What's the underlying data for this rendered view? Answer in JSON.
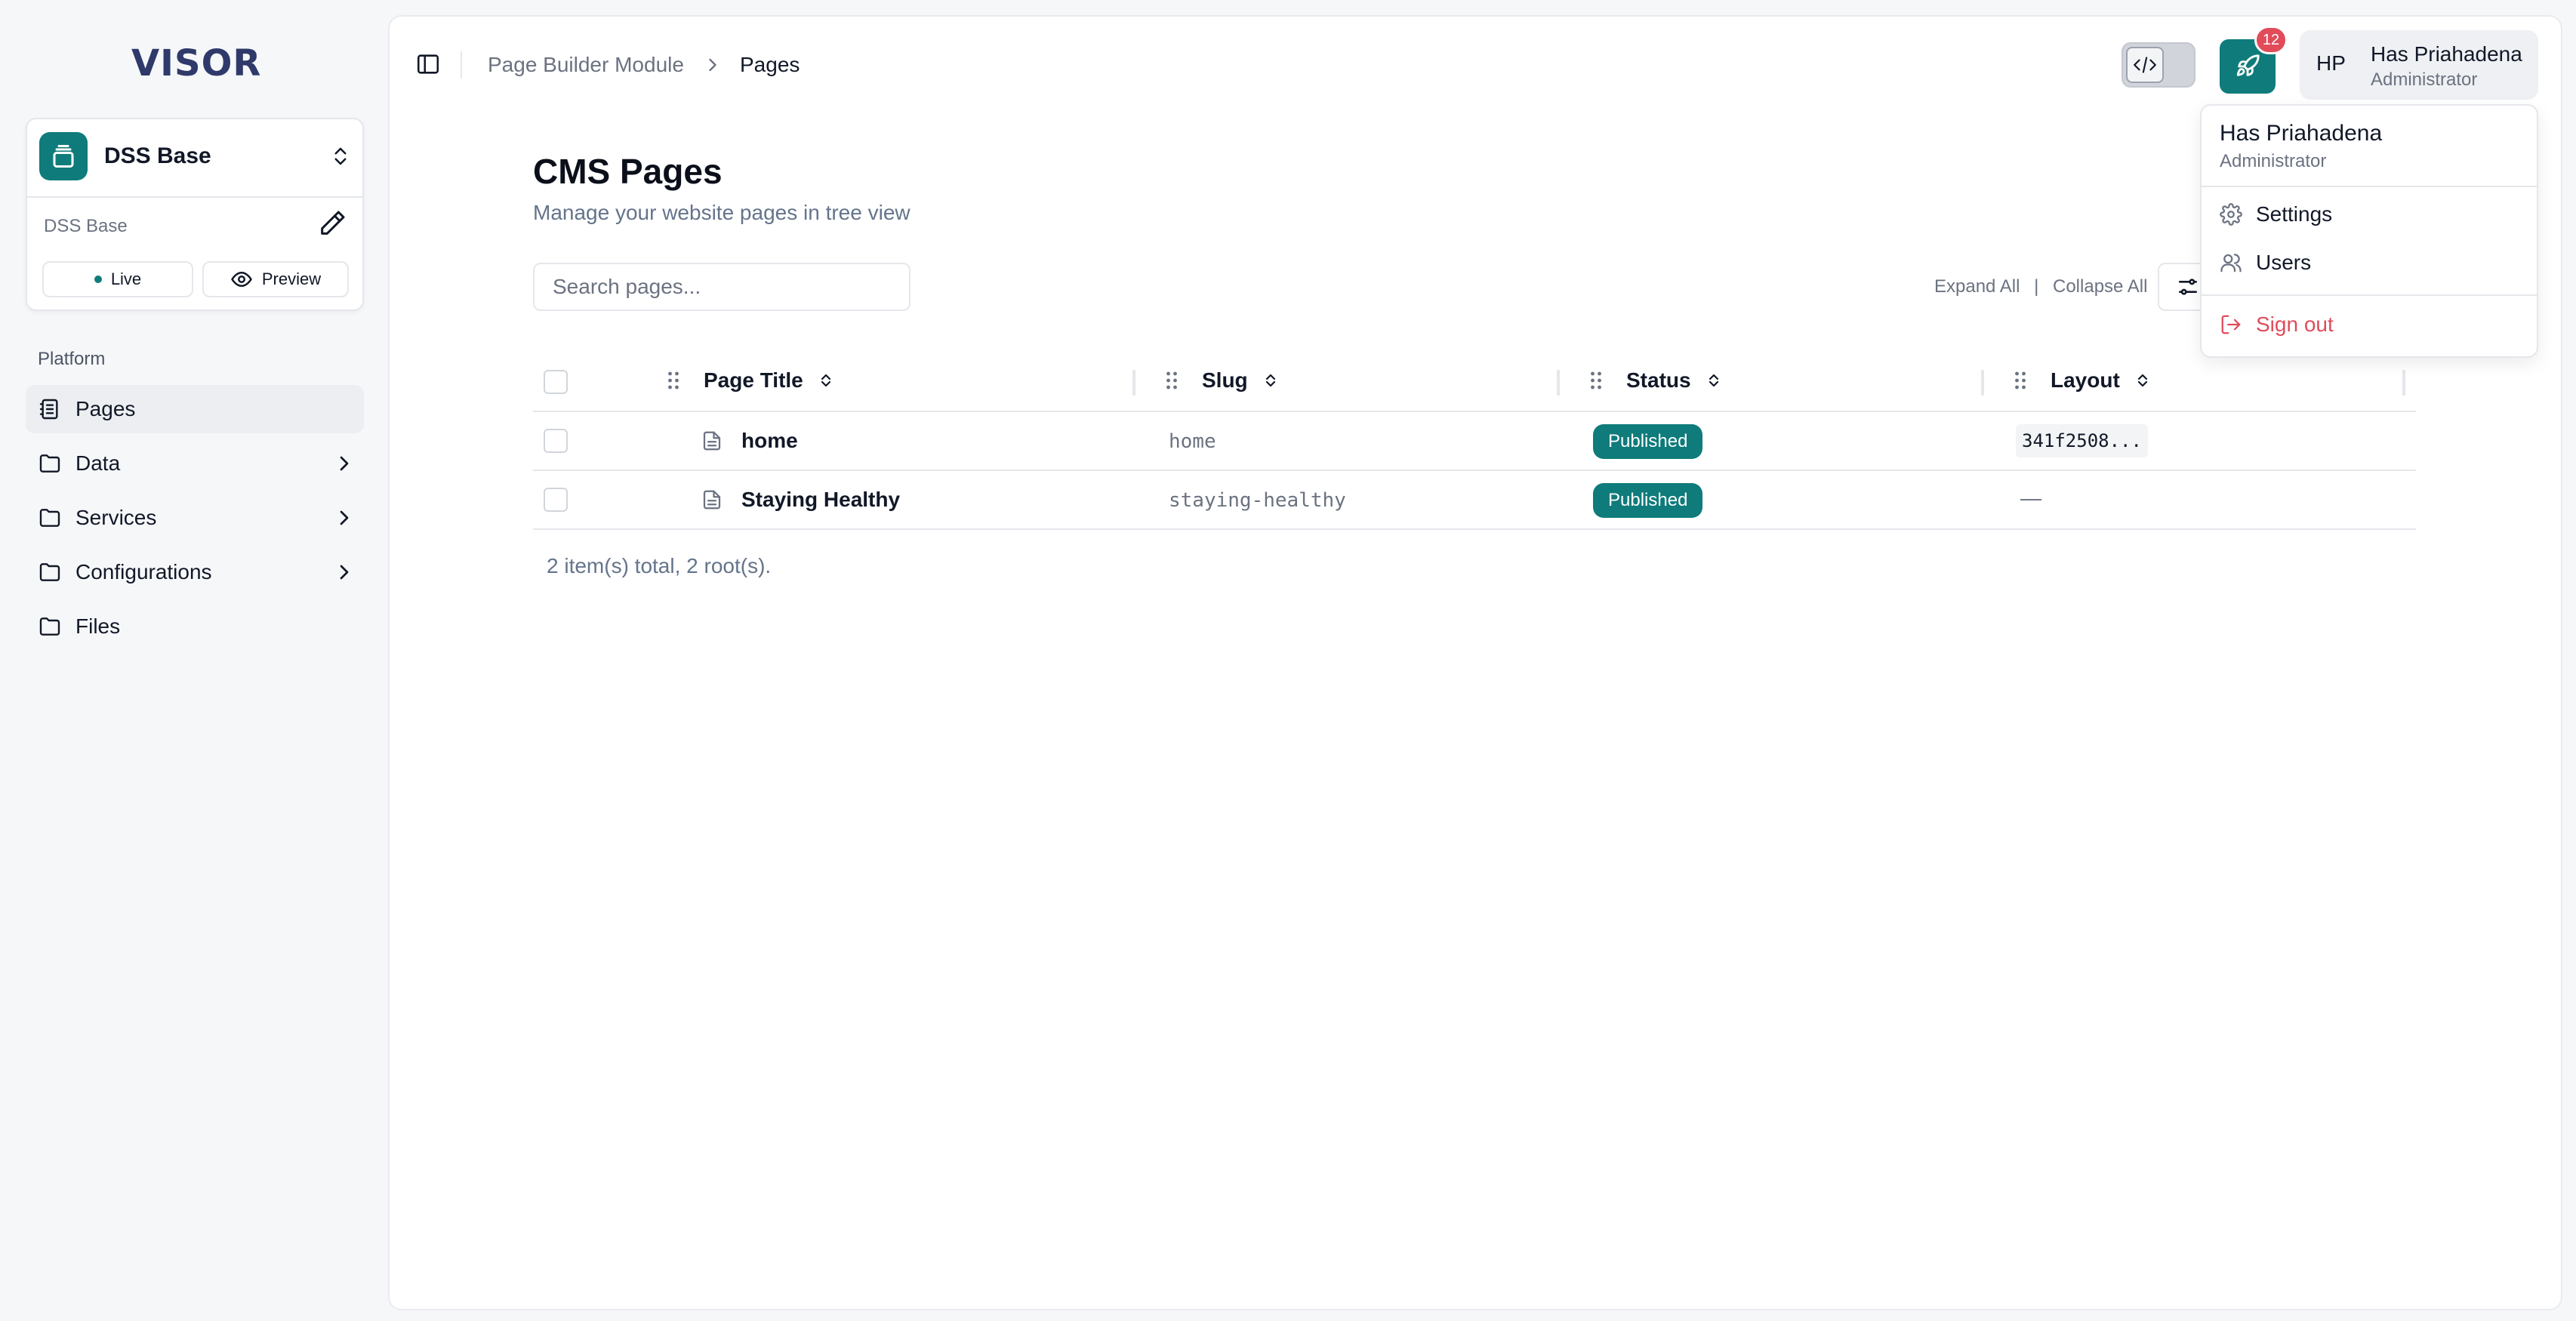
{
  "sidebar": {
    "logo": "VISOR",
    "workspace": {
      "name": "DSS Base",
      "sublabel": "DSS Base",
      "live_label": "Live",
      "preview_label": "Preview"
    },
    "section_label": "Platform",
    "items": [
      {
        "label": "Pages",
        "icon": "pages-icon",
        "active": true
      },
      {
        "label": "Data",
        "icon": "folder-icon"
      },
      {
        "label": "Services",
        "icon": "folder-icon"
      },
      {
        "label": "Configurations",
        "icon": "folder-icon"
      },
      {
        "label": "Files",
        "icon": "folder-icon"
      }
    ]
  },
  "topbar": {
    "breadcrumb": [
      "Page Builder Module",
      "Pages"
    ],
    "notification_count": "12",
    "user": {
      "initials": "HP",
      "name": "Has Priahadena",
      "role": "Administrator"
    }
  },
  "main": {
    "title": "CMS Pages",
    "subtitle": "Manage your website pages in tree view",
    "search_placeholder": "Search pages...",
    "expand_all": "Expand All",
    "separator": "|",
    "collapse_all": "Collapse All",
    "table": {
      "columns": [
        "Page Title",
        "Slug",
        "Status",
        "Layout"
      ],
      "rows": [
        {
          "title": "home",
          "slug": "home",
          "status": "Published",
          "layout": "341f2508..."
        },
        {
          "title": "Staying Healthy",
          "slug": "staying-healthy",
          "status": "Published",
          "layout": "—"
        }
      ]
    },
    "footer": "2 item(s) total, 2 root(s)."
  },
  "dropdown": {
    "name": "Has Priahadena",
    "role": "Administrator",
    "items": [
      {
        "label": "Settings",
        "icon": "gear-icon"
      },
      {
        "label": "Users",
        "icon": "users-icon"
      },
      {
        "label": "Sign out",
        "icon": "sign-out-icon"
      }
    ]
  },
  "colors": {
    "accent": "#0f7b7b",
    "danger": "#e14b5a",
    "brand": "#2f3a6b"
  }
}
